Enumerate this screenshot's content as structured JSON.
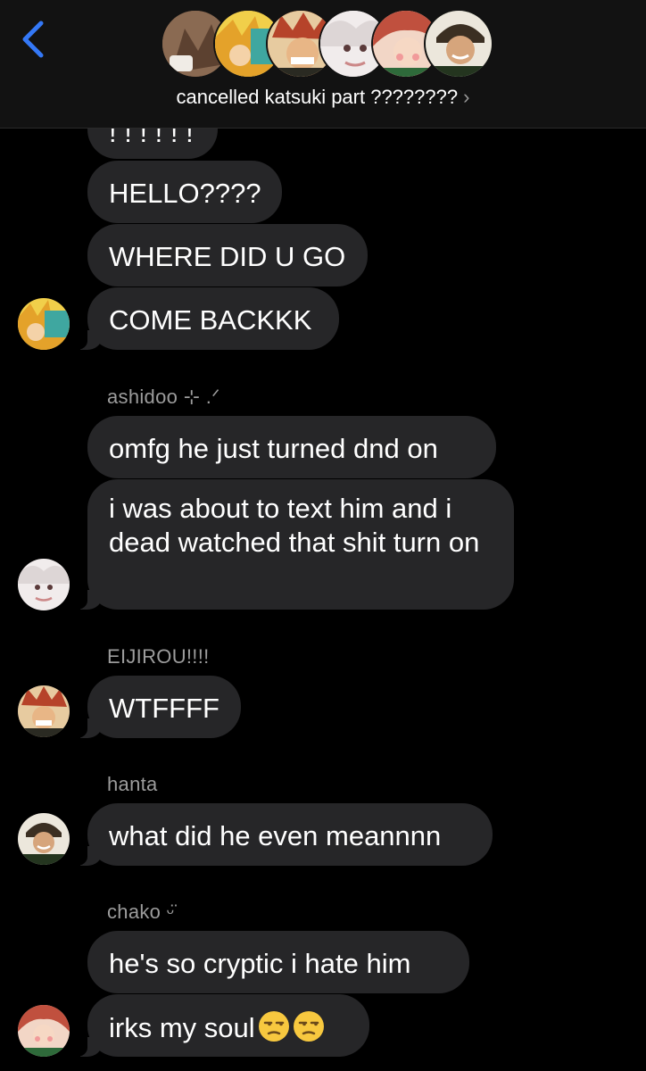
{
  "header": {
    "title": "cancelled katsuki part ????????",
    "chevron": "›",
    "back_icon": "chevron-left-icon",
    "avatar_colors": [
      "#7a5a46",
      "#e9b64a",
      "#c9743a",
      "#ece6e6",
      "#d56b5a",
      "#3d4a35"
    ]
  },
  "messages": [
    {
      "id": "m0",
      "text": "! ! ! ! ! !"
    },
    {
      "id": "m1",
      "text": "HELLO????"
    },
    {
      "id": "m2",
      "text": "WHERE DID U GO"
    },
    {
      "id": "m3",
      "text": "COME BACKKK"
    },
    {
      "id": "m4",
      "sender": "ashidoo ⊹ .ᐟ",
      "text": "omfg he just turned dnd on"
    },
    {
      "id": "m5",
      "text": "i was about to text him and i dead watched that shit turn on"
    },
    {
      "id": "m6",
      "sender": "EIJIROU!!!!",
      "text": "WTFFFF"
    },
    {
      "id": "m7",
      "sender": "hanta",
      "text": "what did he even meannnn"
    },
    {
      "id": "m8",
      "sender": "chako ᵕ̈",
      "text": "he's so cryptic i hate him"
    },
    {
      "id": "m9",
      "text": "irks my soul",
      "emoji": [
        "unamused-face",
        "unamused-face"
      ]
    }
  ],
  "colors": {
    "accent": "#3478f6",
    "bubble": "#262628",
    "header_bg": "#121212",
    "sender_text": "#9c9c9c"
  }
}
